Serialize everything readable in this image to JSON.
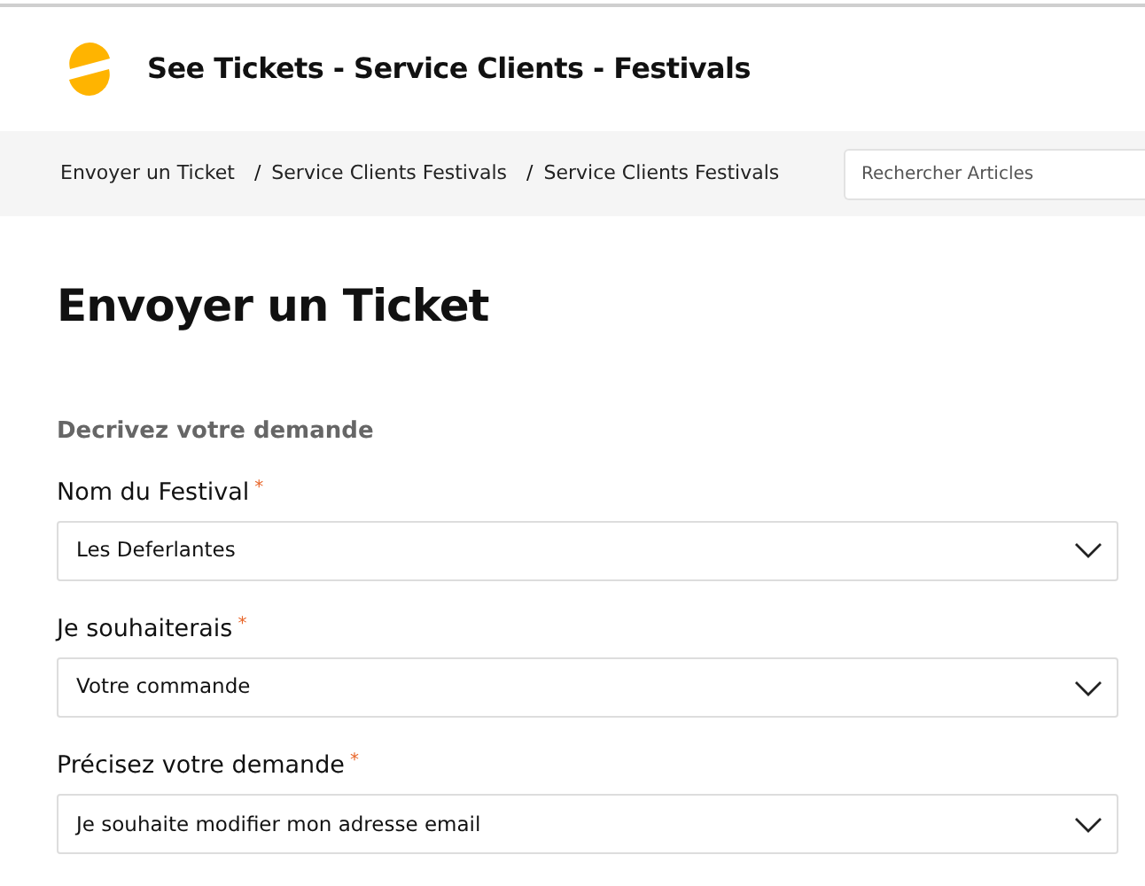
{
  "header": {
    "title": "See Tickets - Service Clients - Festivals"
  },
  "breadcrumb": [
    "Envoyer un Ticket",
    "Service Clients Festivals",
    "Service Clients Festivals"
  ],
  "breadcrumb_separator": "/",
  "search": {
    "placeholder": "Rechercher Articles"
  },
  "page_title": "Envoyer un Ticket",
  "section_title": "Decrivez votre demande",
  "fields": [
    {
      "label": "Nom du Festival",
      "required_mark": "*",
      "value": "Les Deferlantes"
    },
    {
      "label": "Je souhaiterais",
      "required_mark": "*",
      "value": "Votre commande"
    },
    {
      "label": "Précisez votre demande",
      "required_mark": "*",
      "value": "Je souhaite modifier mon adresse email"
    }
  ]
}
